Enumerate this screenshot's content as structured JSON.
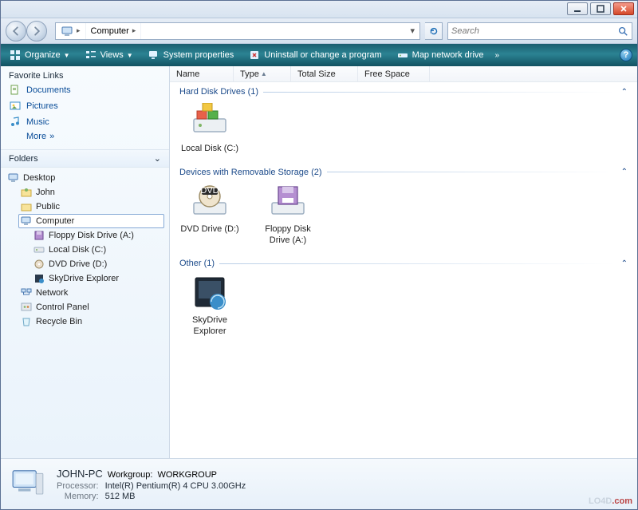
{
  "titlebar": {
    "minimize_icon": "minimize-icon",
    "maximize_icon": "maximize-icon",
    "close_icon": "close-icon"
  },
  "nav": {
    "location_segments": [
      "Computer"
    ],
    "search_placeholder": "Search"
  },
  "command_bar": {
    "organize": "Organize",
    "views": "Views",
    "system_properties": "System properties",
    "uninstall": "Uninstall or change a program",
    "map_drive": "Map network drive",
    "help_glyph": "?"
  },
  "sidebar": {
    "fav_header": "Favorite Links",
    "favs": [
      "Documents",
      "Pictures",
      "Music"
    ],
    "more_label": "More",
    "folders_header": "Folders",
    "tree": {
      "root": {
        "label": "Desktop",
        "children": [
          {
            "label": "John"
          },
          {
            "label": "Public"
          },
          {
            "label": "Computer",
            "selected": true,
            "children": [
              {
                "label": "Floppy Disk Drive (A:)"
              },
              {
                "label": "Local Disk (C:)"
              },
              {
                "label": "DVD Drive (D:)"
              },
              {
                "label": "SkyDrive Explorer"
              }
            ]
          },
          {
            "label": "Network"
          },
          {
            "label": "Control Panel"
          },
          {
            "label": "Recycle Bin"
          }
        ]
      }
    }
  },
  "columns": [
    "Name",
    "Type",
    "Total Size",
    "Free Space"
  ],
  "groups": [
    {
      "title": "Hard Disk Drives (1)",
      "items": [
        {
          "label": "Local Disk (C:)",
          "icon": "hdd"
        }
      ]
    },
    {
      "title": "Devices with Removable Storage (2)",
      "items": [
        {
          "label": "DVD Drive (D:)",
          "icon": "dvd"
        },
        {
          "label": "Floppy Disk Drive (A:)",
          "icon": "floppy"
        }
      ]
    },
    {
      "title": "Other (1)",
      "items": [
        {
          "label": "SkyDrive Explorer",
          "icon": "skydrive"
        }
      ]
    }
  ],
  "details": {
    "computer_name": "JOHN-PC",
    "workgroup_key": "Workgroup:",
    "workgroup_val": "WORKGROUP",
    "processor_key": "Processor:",
    "processor_val": "Intel(R) Pentium(R) 4 CPU 3.00GHz",
    "memory_key": "Memory:",
    "memory_val": "512 MB"
  },
  "brand": {
    "text": "LO4D",
    "suffix": ".com"
  }
}
